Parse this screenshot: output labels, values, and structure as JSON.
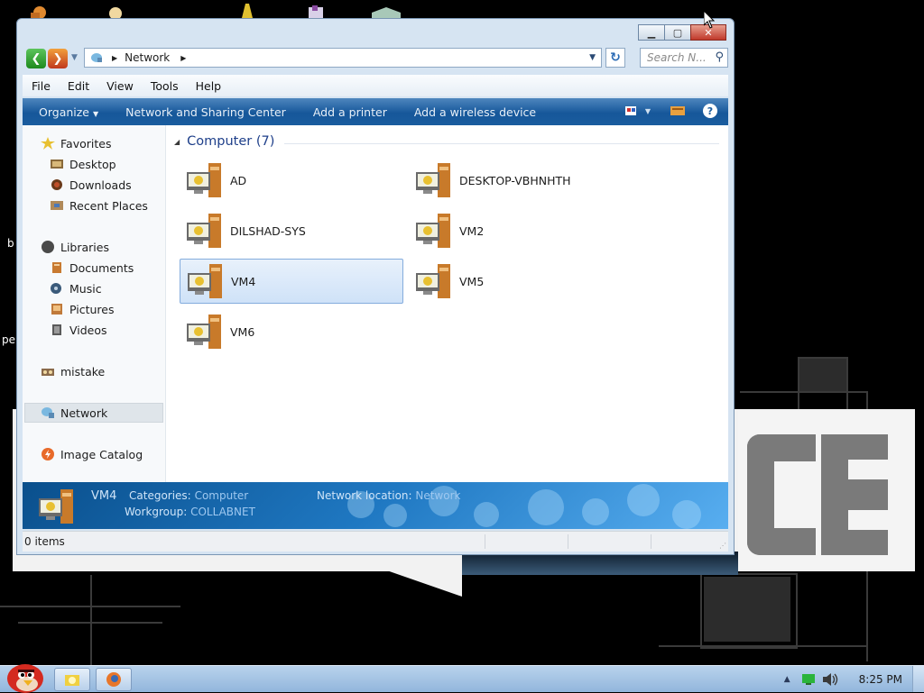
{
  "window": {
    "caption_buttons": {
      "minimize": "▁",
      "maximize": "▢",
      "close": "✕"
    }
  },
  "address_bar": {
    "location": "Network",
    "search_placeholder": "Search N..."
  },
  "menu": [
    "File",
    "Edit",
    "View",
    "Tools",
    "Help"
  ],
  "toolbar": {
    "organize": "Organize",
    "items": [
      "Network and Sharing Center",
      "Add a printer",
      "Add a wireless device"
    ]
  },
  "nav_pane": {
    "favorites": "Favorites",
    "favorites_items": [
      "Desktop",
      "Downloads",
      "Recent Places"
    ],
    "libraries": "Libraries",
    "libraries_items": [
      "Documents",
      "Music",
      "Pictures",
      "Videos"
    ],
    "homegroup": "mistake",
    "network": "Network",
    "image_catalog": "Image Catalog"
  },
  "group": {
    "title": "Computer (7)"
  },
  "computers": [
    "AD",
    "DESKTOP-VBHNHTH",
    "DILSHAD-SYS",
    "VM2",
    "VM4",
    "VM5",
    "VM6"
  ],
  "selected_computer": "VM4",
  "details": {
    "name": "VM4",
    "categories_label": "Categories:",
    "categories_value": "Computer",
    "workgroup_label": "Workgroup:",
    "workgroup_value": "COLLABNET",
    "location_label": "Network location:",
    "location_value": "Network"
  },
  "status_bar": {
    "items": "0 items"
  },
  "desktop_text": [
    "b",
    "pe"
  ],
  "taskbar": {
    "clock": "8:25 PM"
  },
  "colors": {
    "toolbar": "#1a5c9e",
    "group_header": "#1e3f8a",
    "selection": "#cfe2f8"
  }
}
